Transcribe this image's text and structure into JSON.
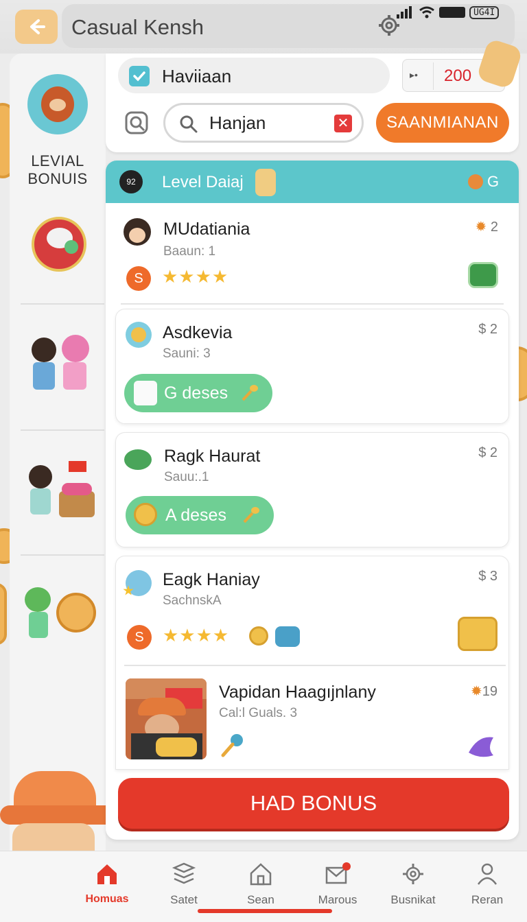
{
  "app": {
    "title": "Casual Kensh"
  },
  "status_bar": {
    "battery_label": "UG4I"
  },
  "sidebar": {
    "items": [
      {
        "label": "LEVIAL\nBONUIS"
      }
    ]
  },
  "account": {
    "name": "Haviiaan",
    "coins": "200"
  },
  "search": {
    "value": "Hanjan",
    "button_label": "SAANMIANAN"
  },
  "list": {
    "header": {
      "badge": "92",
      "title": "Level Daiaj",
      "right_value": "G"
    },
    "rows": [
      {
        "title": "MUdatiania",
        "subtitle": "Baaun: 1",
        "badge": "S",
        "stars": "★★★★",
        "right": "2"
      },
      {
        "title": "Asdkevia",
        "subtitle": "Sauni: 3",
        "button": "G deses",
        "right": "$ 2"
      },
      {
        "title": "Ragk Haurat",
        "subtitle": "Sauu:.1",
        "button": "A deses",
        "right": "$ 2"
      },
      {
        "title": "Eagk Haniay",
        "subtitle": "SachnskA",
        "badge": "S",
        "stars": "★★★★",
        "right": "$ 3"
      },
      {
        "title": "Vapidan Haagıjnlany",
        "subtitle": "Cal:l Guals. 3",
        "right": "19"
      }
    ],
    "cta_label": "HAD BONUS"
  },
  "bottom_nav": [
    {
      "label": "Homuas"
    },
    {
      "label": "Satet"
    },
    {
      "label": "Sean"
    },
    {
      "label": "Marous"
    },
    {
      "label": "Busnikat"
    },
    {
      "label": "Reran"
    }
  ],
  "colors": {
    "accent": "#e4392a",
    "teal": "#5cc6cb",
    "orange": "#f07a2a",
    "green": "#6fcf94"
  }
}
